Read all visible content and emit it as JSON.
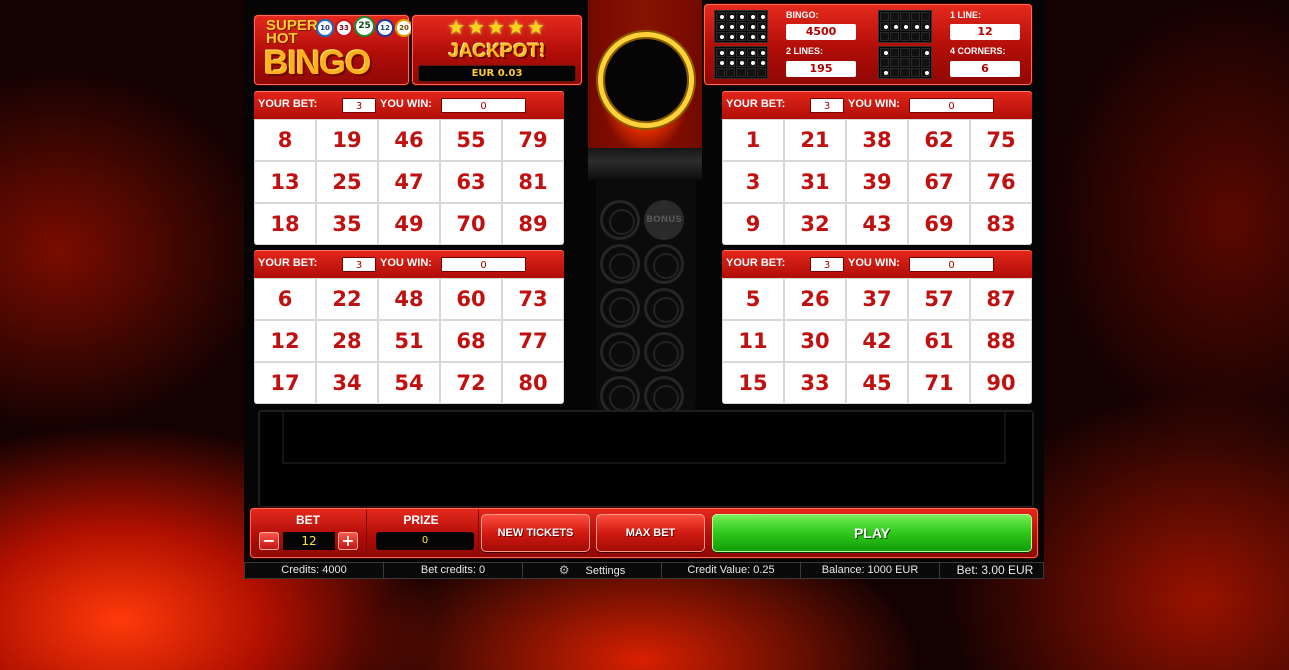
{
  "logo": {
    "super": "SUPER",
    "hot": "HOT",
    "bingo": "BINGO",
    "balls": [
      "10",
      "33",
      "25",
      "12",
      "20"
    ]
  },
  "jackpot": {
    "stars": "★★★★★",
    "title": "JACKPOT!",
    "value": "EUR 0.03"
  },
  "bonus_label": "BONUS",
  "paytable": {
    "bingo_label": "BINGO:",
    "bingo_value": "4500",
    "two_lines_label": "2 LINES:",
    "two_lines_value": "195",
    "one_line_label": "1 LINE:",
    "one_line_value": "12",
    "four_corners_label": "4 CORNERS:",
    "four_corners_value": "6"
  },
  "card_labels": {
    "your_bet": "YOUR BET:",
    "you_win": "YOU WIN:"
  },
  "cards": [
    {
      "bet": "3",
      "win": "0",
      "numbers": [
        8,
        19,
        46,
        55,
        79,
        13,
        25,
        47,
        63,
        81,
        18,
        35,
        49,
        70,
        89
      ]
    },
    {
      "bet": "3",
      "win": "0",
      "numbers": [
        1,
        21,
        38,
        62,
        75,
        3,
        31,
        39,
        67,
        76,
        9,
        32,
        43,
        69,
        83
      ]
    },
    {
      "bet": "3",
      "win": "0",
      "numbers": [
        6,
        22,
        48,
        60,
        73,
        12,
        28,
        51,
        68,
        77,
        17,
        34,
        54,
        72,
        80
      ]
    },
    {
      "bet": "3",
      "win": "0",
      "numbers": [
        5,
        26,
        37,
        57,
        87,
        11,
        30,
        42,
        61,
        88,
        15,
        33,
        45,
        71,
        90
      ]
    }
  ],
  "controls": {
    "bet_label": "BET",
    "bet_value": "12",
    "minus": "−",
    "plus": "+",
    "prize_label": "PRIZE",
    "prize_value": "0",
    "new_tickets": "NEW TICKETS",
    "max_bet": "MAX BET",
    "play": "PLAY"
  },
  "status": {
    "credits": "Credits: 4000",
    "bet_credits": "Bet credits: 0",
    "settings": "Settings",
    "credit_value": "Credit Value: 0.25",
    "balance": "Balance: 1000 EUR",
    "bet": "Bet: 3.00 EUR"
  }
}
